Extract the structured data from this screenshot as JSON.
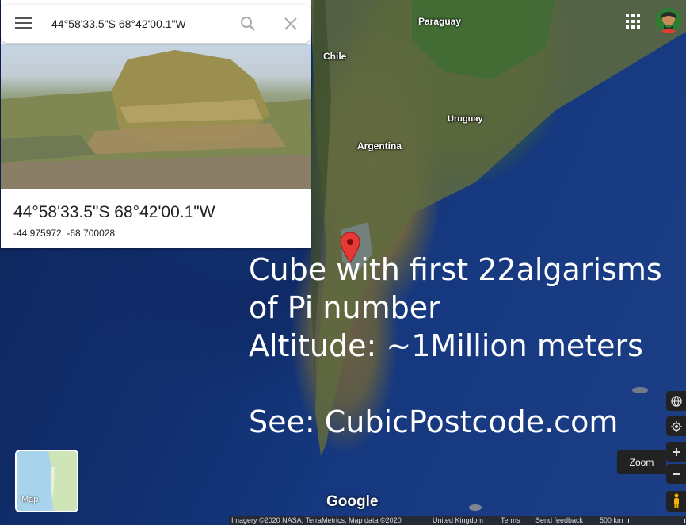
{
  "search": {
    "menu_icon": "menu-icon",
    "query": "44°58'33.5\"S 68°42'00.1\"W",
    "search_icon": "search-icon",
    "close_icon": "close-icon"
  },
  "place": {
    "title": "44°58'33.5\"S 68°42'00.1\"W",
    "decimal_coordinates": "-44.975972, -68.700028"
  },
  "map_labels": {
    "paraguay": "Paraguay",
    "chile": "Chile",
    "uruguay": "Uruguay",
    "argentina": "Argentina"
  },
  "overlay": {
    "text": "Cube with first 22algarisms\nof Pi number\nAltitude: ~1Million meters\n\nSee: CubicPostcode.com"
  },
  "controls": {
    "apps_icon": "apps-grid-icon",
    "globe_icon": "globe-icon",
    "location_icon": "my-location-icon",
    "zoom_in_icon": "plus-icon",
    "zoom_out_icon": "minus-icon",
    "zoom_label": "Zoom",
    "pegman_icon": "pegman-icon"
  },
  "minimap": {
    "label": "Map"
  },
  "branding": {
    "logo": "Google"
  },
  "footer": {
    "imagery": "Imagery ©2020 NASA, TerraMetrics, Map data ©2020",
    "region": "United Kingdom",
    "terms": "Terms",
    "feedback": "Send feedback",
    "scale": "500 km"
  },
  "colors": {
    "pin": "#e53935",
    "ocean": "#15387f"
  }
}
